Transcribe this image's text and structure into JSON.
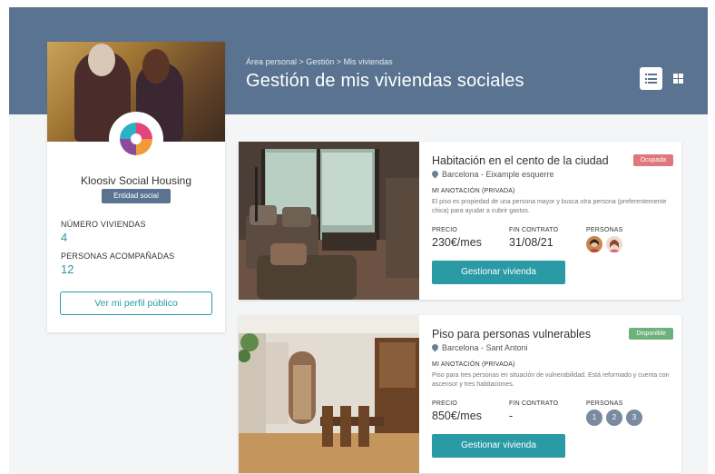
{
  "header": {
    "breadcrumb": "Área personal > Gestión > Mis viviendas",
    "title": "Gestión de mis viviendas sociales",
    "view_toggle": {
      "list_icon": "list-view-icon",
      "grid_icon": "grid-view-icon",
      "active": "list"
    }
  },
  "profile": {
    "name": "Kloosiv Social Housing",
    "badge": "Entidad social",
    "stats": [
      {
        "label": "NÚMERO VIVIENDAS",
        "value": "4"
      },
      {
        "label": "PERSONAS ACOMPAÑADAS",
        "value": "12"
      }
    ],
    "button": "Ver mi perfil público"
  },
  "listings": [
    {
      "title": "Habitación en el cento de la ciudad",
      "status": "Ocupada",
      "status_color": "#e0777b",
      "location": "Barcelona - Eixample esquerre",
      "note_label": "MI ANOTACIÓN (PRIVADA)",
      "note": "El piso es propiedad de una persona mayor y busca otra persona (preferentemente chica) para ayudar a cubrir gastos.",
      "price_label": "PRECIO",
      "price": "230€/mes",
      "contract_label": "FIN CONTRATO",
      "contract": "31/08/21",
      "people_label": "PERSONAS",
      "button": "Gestionar vivienda"
    },
    {
      "title": "Piso para personas vulnerables",
      "status": "Disponible",
      "status_color": "#6fb17a",
      "location": "Barcelona - Sant Antoni",
      "note_label": "MI ANOTACIÓN (PRIVADA)",
      "note": "Piso para tres personas en situación de vulnerabilidad. Está reformado y cuenta con ascensor y tres habitaciones.",
      "price_label": "PRECIO",
      "price": "850€/mes",
      "contract_label": "FIN CONTRATO",
      "contract": "-",
      "people_label": "PERSONAS",
      "slots": [
        "1",
        "2",
        "3"
      ],
      "button": "Gestionar vivienda"
    }
  ],
  "colors": {
    "header": "#5a7390",
    "accent": "#2a9aa5",
    "background": "#f4f5f7"
  }
}
